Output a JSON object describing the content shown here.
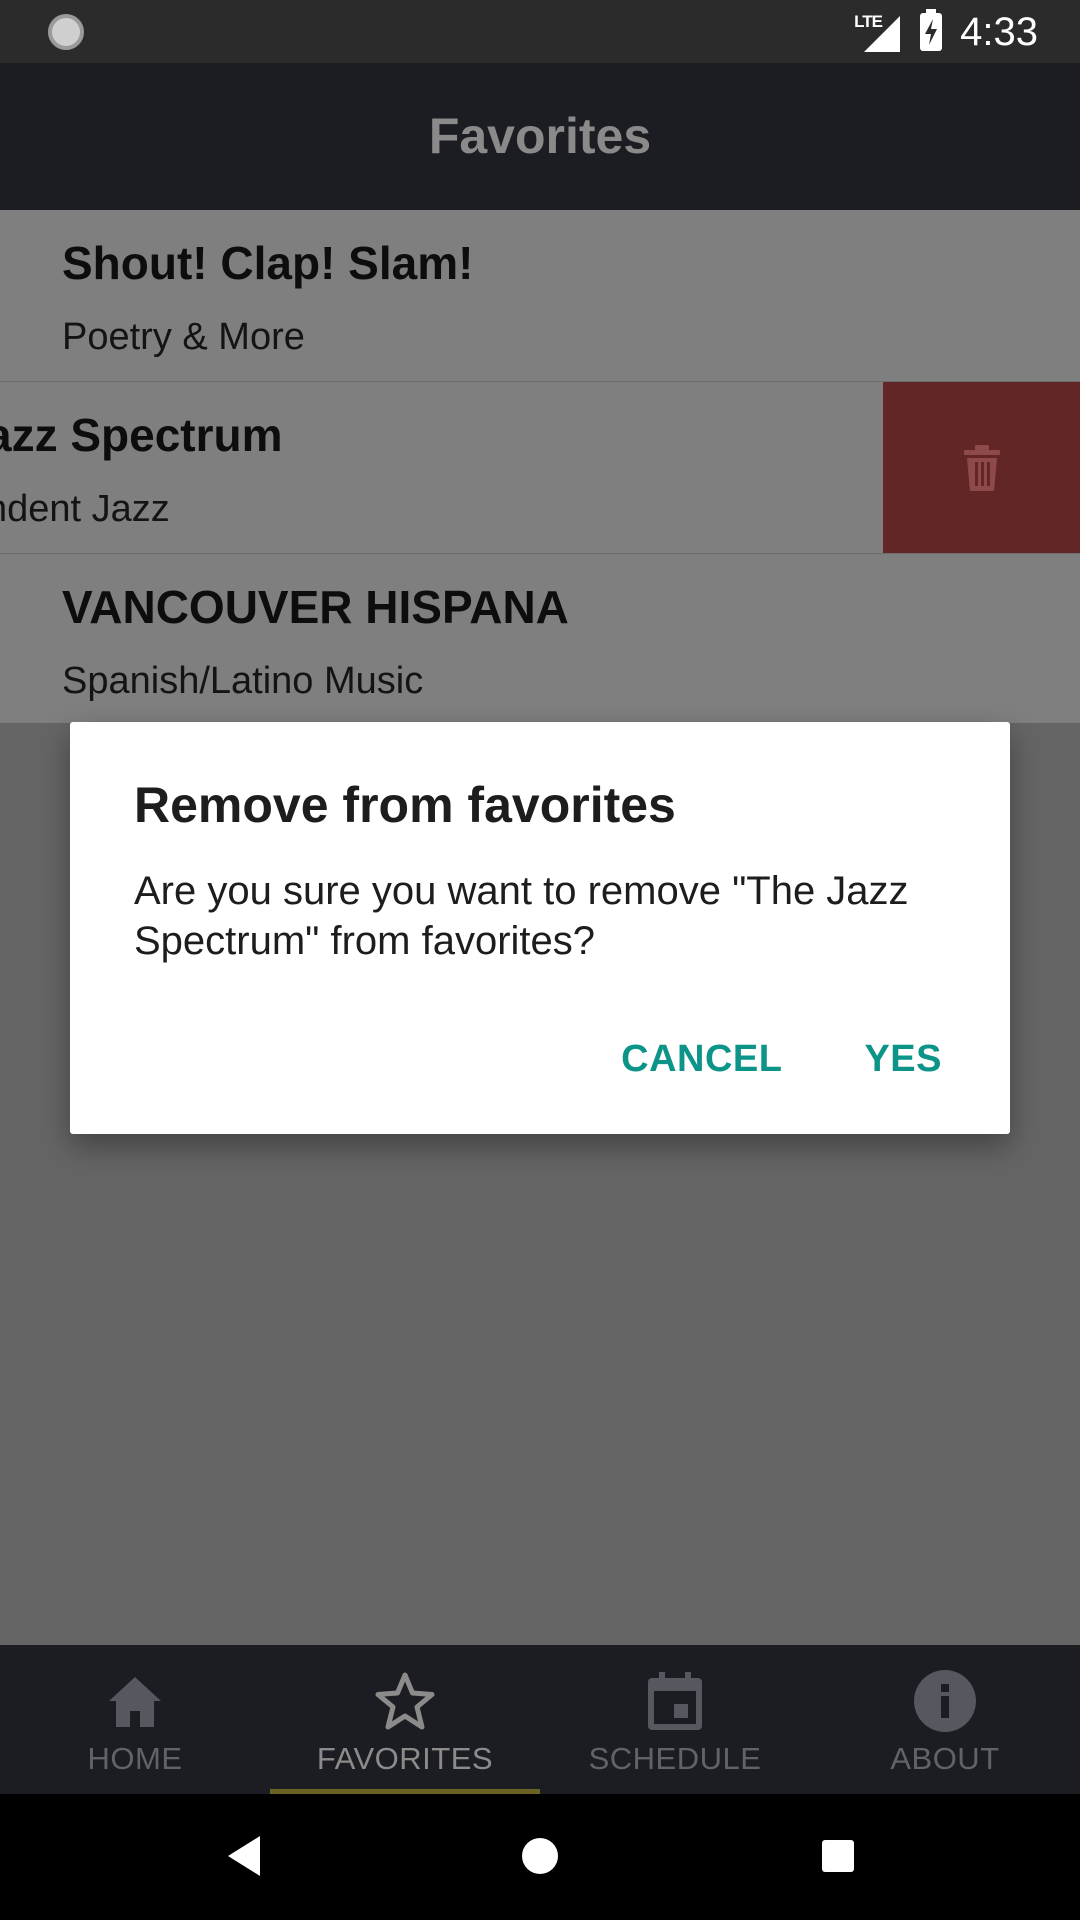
{
  "status_bar": {
    "time": "4:33",
    "network_label": "LTE",
    "icons": [
      "loading-spinner-icon",
      "signal-icon",
      "battery-charging-icon"
    ]
  },
  "app_bar": {
    "title": "Favorites"
  },
  "favorites": [
    {
      "title": "Shout! Clap! Slam!",
      "subtitle": "Poetry & More"
    },
    {
      "title": "The Jazz Spectrum",
      "subtitle": "Independent Jazz",
      "visible_title": "azz Spectrum",
      "visible_subtitle": "ndent Jazz",
      "swiped": true
    },
    {
      "title": "VANCOUVER HISPANA",
      "subtitle": "Spanish/Latino Music"
    }
  ],
  "delete_action": {
    "icon": "trash-icon",
    "color": "#632626"
  },
  "dialog": {
    "title": "Remove from favorites",
    "message": "Are you sure you want to remove \"The Jazz Spectrum\" from favorites?",
    "cancel_label": "CANCEL",
    "confirm_label": "YES",
    "accent_color": "#0d9488"
  },
  "bottom_nav": {
    "items": [
      {
        "label": "HOME",
        "icon": "home-icon"
      },
      {
        "label": "FAVORITES",
        "icon": "star-icon",
        "active": true
      },
      {
        "label": "SCHEDULE",
        "icon": "calendar-icon"
      },
      {
        "label": "ABOUT",
        "icon": "info-icon"
      }
    ],
    "active_color": "#6b6322"
  },
  "system_nav": {
    "icons": [
      "back-icon",
      "home-circle-icon",
      "recents-icon"
    ]
  }
}
